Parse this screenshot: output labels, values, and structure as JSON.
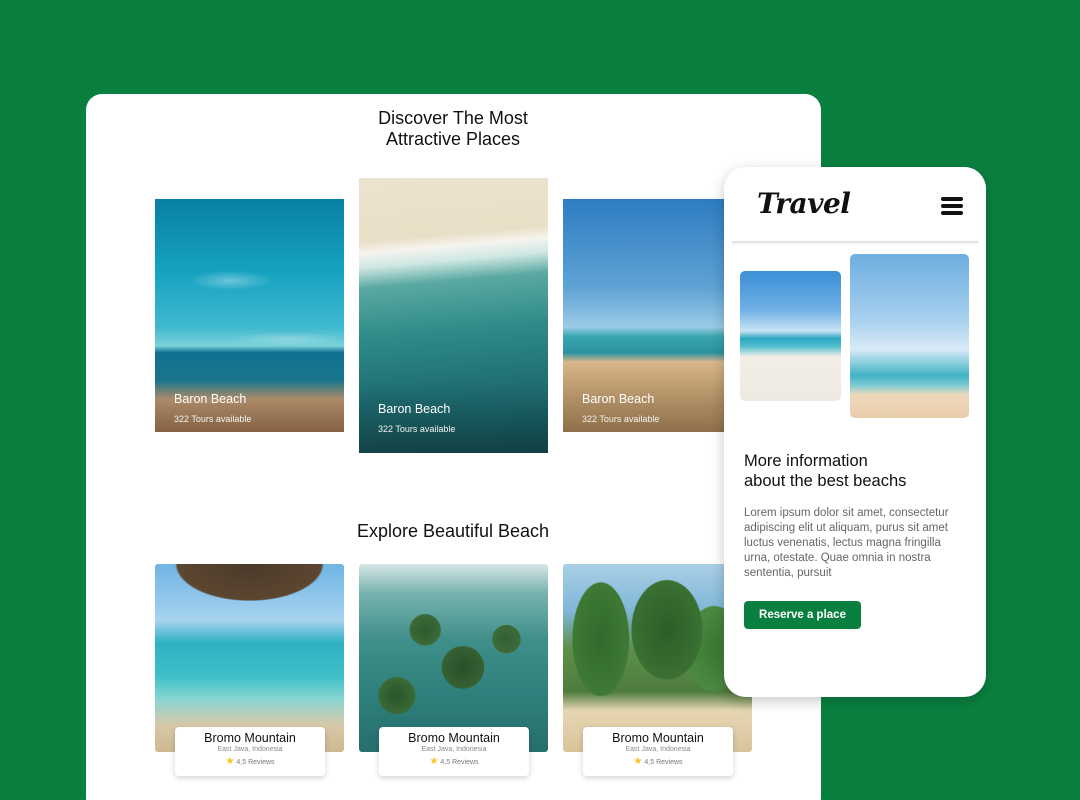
{
  "colors": {
    "background": "#0a8040",
    "accent": "#0a8040",
    "card": "#ffffff"
  },
  "desktop": {
    "heading_line1": "Discover The Most",
    "heading_line2": "Attractive Places",
    "places": [
      {
        "name": "Baron Beach",
        "tours": "322 Tours available",
        "image": "beach-shoreline"
      },
      {
        "name": "Baron Beach",
        "tours": "322 Tours available",
        "image": "aerial-waves"
      },
      {
        "name": "Baron Beach",
        "tours": "322 Tours available",
        "image": "beach-umbrella"
      }
    ],
    "explore_heading": "Explore Beautiful Beach",
    "mountains": [
      {
        "name": "Bromo Mountain",
        "location": "East Java, Indonesia",
        "reviews": "4,5 Reviews",
        "image": "sea-cave"
      },
      {
        "name": "Bromo Mountain",
        "location": "East Java, Indonesia",
        "reviews": "4,5 Reviews",
        "image": "islands"
      },
      {
        "name": "Bromo Mountain",
        "location": "East Java, Indonesia",
        "reviews": "4,5 Reviews",
        "image": "palm-beach"
      }
    ]
  },
  "mobile": {
    "logo": "Travel",
    "menu_icon": "hamburger-icon",
    "title_line1": "More information",
    "title_line2": "about the best beachs",
    "body": "Lorem ipsum dolor sit amet, consectetur adipiscing elit ut aliquam, purus sit amet luctus venenatis, lectus magna fringilla urna, otestate. Quae omnia in nostra sententia, pursuit",
    "button": "Reserve a place"
  }
}
